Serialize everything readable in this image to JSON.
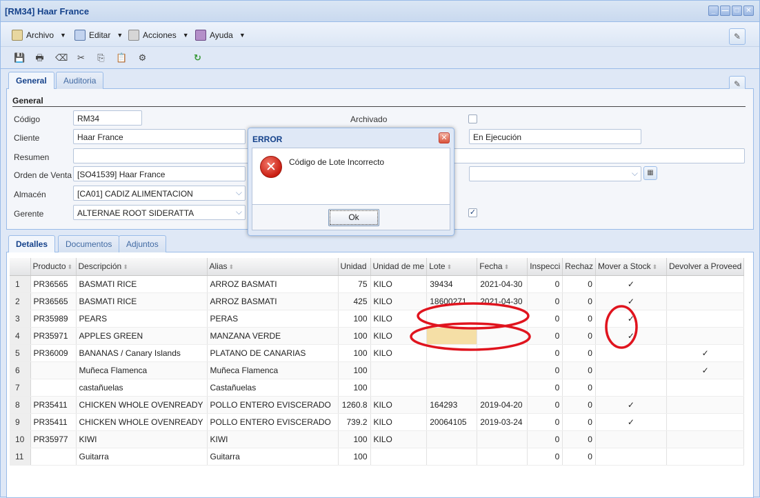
{
  "window": {
    "title": "[RM34] Haar France",
    "controls": [
      "_",
      "—",
      "□",
      "✕"
    ]
  },
  "menu": [
    {
      "label": "Archivo",
      "icon": "archive-icon",
      "color": "#e8d7a0"
    },
    {
      "label": "Editar",
      "icon": "edit-icon",
      "color": "#c2d3ef"
    },
    {
      "label": "Acciones",
      "icon": "actions-icon",
      "color": "#d6d6d6"
    },
    {
      "label": "Ayuda",
      "icon": "help-book-icon",
      "color": "#b48fc9"
    }
  ],
  "toolbar": {
    "icons": [
      "save-icon",
      "print-icon",
      "delete-icon",
      "cut-icon",
      "copy-icon",
      "paste-icon",
      "tools-icon",
      "refresh-icon"
    ],
    "glyphs": [
      "💾",
      "🖶",
      "⌫",
      "✂",
      "⎘",
      "📋",
      "⚙",
      "↻"
    ]
  },
  "header_tabs": [
    "General",
    "Auditoria"
  ],
  "form": {
    "section": "General",
    "codigo_label": "Código",
    "codigo": "RM34",
    "archivado_label": "Archivado",
    "cliente_label": "Cliente",
    "cliente": "Haar France",
    "estado": "En Ejecución",
    "resumen_label": "Resumen",
    "resumen": "",
    "orden_label": "Orden de Venta",
    "orden": "[SO41539] Haar France",
    "almacen_label": "Almacén",
    "almacen": "[CA01] CADIZ ALIMENTACION",
    "gerente_label": "Gerente",
    "gerente": "ALTERNAE ROOT SIDERATTA"
  },
  "detail_tabs": [
    "Detalles",
    "Documentos",
    "Adjuntos"
  ],
  "grid": {
    "columns": [
      "Producto",
      "Descripción",
      "Alias",
      "Unidad",
      "Unidad de me",
      "Lote",
      "Fecha",
      "Inspecci",
      "Rechaz",
      "Mover a Stock",
      "Devolver a Proveed"
    ],
    "rows": [
      {
        "n": "1",
        "producto": "PR36565",
        "desc": "BASMATI RICE",
        "alias": "ARROZ BASMATI",
        "unidades": "75",
        "unidad": "KILO",
        "lote": "39434",
        "fecha": "2021-04-30",
        "insp": "0",
        "rech": "0",
        "mover": "✓",
        "devolver": ""
      },
      {
        "n": "2",
        "producto": "PR36565",
        "desc": "BASMATI RICE",
        "alias": "ARROZ BASMATI",
        "unidades": "425",
        "unidad": "KILO",
        "lote": "18600271",
        "fecha": "2021-04-30",
        "insp": "0",
        "rech": "0",
        "mover": "✓",
        "devolver": ""
      },
      {
        "n": "3",
        "producto": "PR35989",
        "desc": "PEARS",
        "alias": "PERAS",
        "unidades": "100",
        "unidad": "KILO",
        "lote": "",
        "fecha": "",
        "insp": "0",
        "rech": "0",
        "mover": "✓",
        "devolver": ""
      },
      {
        "n": "4",
        "producto": "PR35971",
        "desc": "APPLES GREEN",
        "alias": "MANZANA VERDE",
        "unidades": "100",
        "unidad": "KILO",
        "lote": "",
        "fecha": "",
        "insp": "0",
        "rech": "0",
        "mover": "✓",
        "devolver": ""
      },
      {
        "n": "5",
        "producto": "PR36009",
        "desc": "BANANAS / Canary Islands",
        "alias": "PLATANO DE CANARIAS",
        "unidades": "100",
        "unidad": "KILO",
        "lote": "",
        "fecha": "",
        "insp": "0",
        "rech": "0",
        "mover": "",
        "devolver": "✓"
      },
      {
        "n": "6",
        "producto": "",
        "desc": "Muñeca Flamenca",
        "alias": "Muñeca Flamenca",
        "unidades": "100",
        "unidad": "",
        "lote": "",
        "fecha": "",
        "insp": "0",
        "rech": "0",
        "mover": "",
        "devolver": "✓"
      },
      {
        "n": "7",
        "producto": "",
        "desc": "castañuelas",
        "alias": "Castañuelas",
        "unidades": "100",
        "unidad": "",
        "lote": "",
        "fecha": "",
        "insp": "0",
        "rech": "0",
        "mover": "",
        "devolver": ""
      },
      {
        "n": "8",
        "producto": "PR35411",
        "desc": "CHICKEN WHOLE OVENREADY",
        "alias": "POLLO ENTERO EVISCERADO",
        "unidades": "1260.8",
        "unidad": "KILO",
        "lote": "164293",
        "fecha": "2019-04-20",
        "insp": "0",
        "rech": "0",
        "mover": "✓",
        "devolver": ""
      },
      {
        "n": "9",
        "producto": "PR35411",
        "desc": "CHICKEN WHOLE OVENREADY",
        "alias": "POLLO ENTERO EVISCERADO",
        "unidades": "739.2",
        "unidad": "KILO",
        "lote": "20064105",
        "fecha": "2019-03-24",
        "insp": "0",
        "rech": "0",
        "mover": "✓",
        "devolver": ""
      },
      {
        "n": "10",
        "producto": "PR35977",
        "desc": "KIWI",
        "alias": "KIWI",
        "unidades": "100",
        "unidad": "KILO",
        "lote": "",
        "fecha": "",
        "insp": "0",
        "rech": "0",
        "mover": "",
        "devolver": ""
      },
      {
        "n": "11",
        "producto": "",
        "desc": "Guitarra",
        "alias": "Guitarra",
        "unidades": "100",
        "unidad": "",
        "lote": "",
        "fecha": "",
        "insp": "0",
        "rech": "0",
        "mover": "",
        "devolver": ""
      }
    ]
  },
  "dialog": {
    "title": "ERROR",
    "message": "Código de Lote Incorrecto",
    "ok_label": "Ok",
    "close_glyph": "✕",
    "icon_glyph": "✕"
  },
  "colors": {
    "annotation": "#e0141e",
    "highlight": "#f5dfa6",
    "header_text": "#15428b"
  }
}
